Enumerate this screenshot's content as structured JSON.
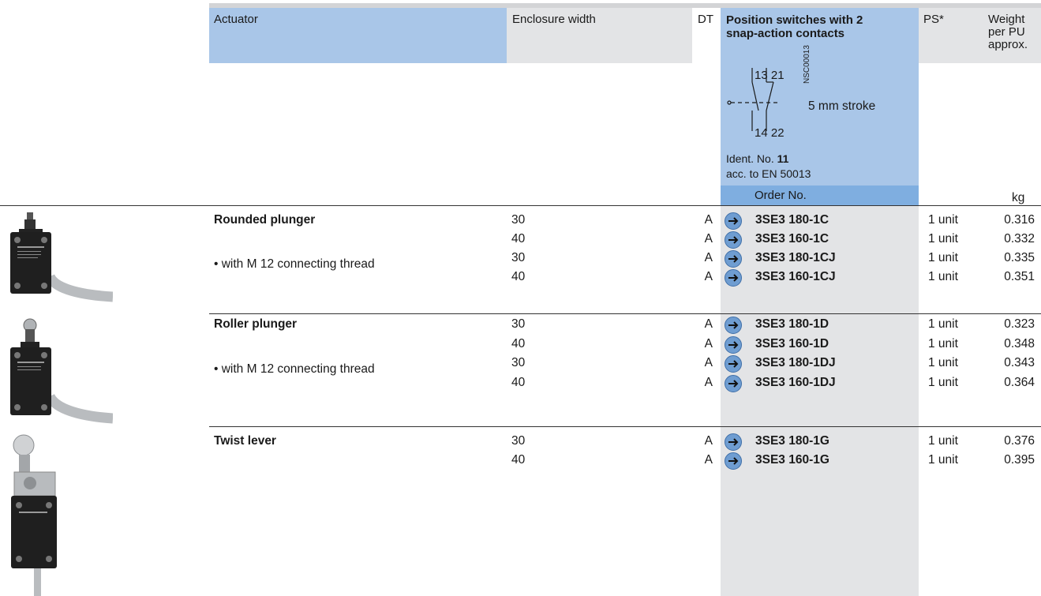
{
  "header": {
    "actuator": "Actuator",
    "enclosure_width": "Enclosure width",
    "dt": "DT",
    "position_switches": "Position switches with 2 snap-action contacts",
    "ps": "PS*",
    "weight": "Weight per PU approx.",
    "weight_lines": [
      "Weight",
      "per PU",
      "approx."
    ]
  },
  "contact_block": {
    "terminals_top": "13 21",
    "terminals_bottom": "14 22",
    "drawing_code": "NSC00013",
    "stroke": "5 mm stroke",
    "ident_prefix": "Ident. No. ",
    "ident_no": "11",
    "standard": "acc. to EN 50013"
  },
  "subheader": {
    "order_no": "Order No.",
    "unit": "kg"
  },
  "sections": [
    {
      "name": "Rounded plunger",
      "variant": "• with M 12 connecting thread",
      "rows": [
        {
          "width": "30",
          "dt": "A",
          "order": "3SE3 180-1C",
          "ps": "1 unit",
          "weight": "0.316"
        },
        {
          "width": "40",
          "dt": "A",
          "order": "3SE3 160-1C",
          "ps": "1 unit",
          "weight": "0.332"
        },
        {
          "width": "30",
          "dt": "A",
          "order": "3SE3 180-1CJ",
          "ps": "1 unit",
          "weight": "0.335"
        },
        {
          "width": "40",
          "dt": "A",
          "order": "3SE3 160-1CJ",
          "ps": "1 unit",
          "weight": "0.351"
        }
      ]
    },
    {
      "name": "Roller plunger",
      "variant": "• with M 12 connecting thread",
      "rows": [
        {
          "width": "30",
          "dt": "A",
          "order": "3SE3 180-1D",
          "ps": "1 unit",
          "weight": "0.323"
        },
        {
          "width": "40",
          "dt": "A",
          "order": "3SE3 160-1D",
          "ps": "1 unit",
          "weight": "0.348"
        },
        {
          "width": "30",
          "dt": "A",
          "order": "3SE3 180-1DJ",
          "ps": "1 unit",
          "weight": "0.343"
        },
        {
          "width": "40",
          "dt": "A",
          "order": "3SE3 160-1DJ",
          "ps": "1 unit",
          "weight": "0.364"
        }
      ]
    },
    {
      "name": "Twist lever",
      "variant": "",
      "rows": [
        {
          "width": "30",
          "dt": "A",
          "order": "3SE3 180-1G",
          "ps": "1 unit",
          "weight": "0.376"
        },
        {
          "width": "40",
          "dt": "A",
          "order": "3SE3 160-1G",
          "ps": "1 unit",
          "weight": "0.395"
        }
      ]
    }
  ],
  "product_images": [
    "rounded-plunger-switch",
    "roller-plunger-switch",
    "twist-lever-switch"
  ],
  "colors": {
    "header_blue": "#a9c6e8",
    "order_blue": "#7faee0",
    "grey_fill": "#e3e4e6",
    "arrow_blue": "#6f9dd1"
  }
}
